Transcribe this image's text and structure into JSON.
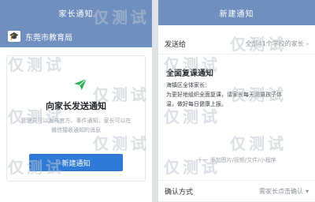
{
  "left_panel": {
    "header_title": "家长通知",
    "org_name": "东莞市教育局",
    "card_title": "向家长发送通知",
    "card_desc_line1": "管理员可以发布官方、事件通知，家长可以在",
    "card_desc_line2": "微信接收通知的消息",
    "new_button_label": "新建通知"
  },
  "right_panel": {
    "header_title": "新建通知",
    "send_to_label": "发送给",
    "send_to_value": "全部41个学校的家长",
    "notice_title": "全面复课通知",
    "notice_body_line1": "海镇区全体家长：",
    "notice_body_line2": "为更好地组织全面复课，请家长每天测量孩子体",
    "notice_body_line3": "温，做好每日健康上报。",
    "attach_hint": "十一 添加图片/视频/文件/小程序",
    "confirm_label": "确认方式",
    "confirm_value": "需家长点击确认"
  },
  "watermark": {
    "text": "仅测试"
  }
}
